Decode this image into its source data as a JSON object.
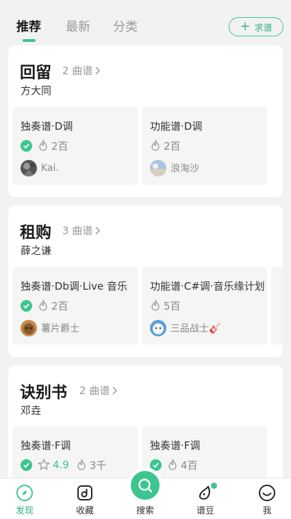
{
  "tabs": [
    "推荐",
    "最新",
    "分类"
  ],
  "request_button": "求谱",
  "cards": [
    {
      "title": "回留",
      "count": "2 曲谱",
      "artist": "方大同",
      "scores": [
        {
          "name": "独奏谱·D调",
          "verified": true,
          "heat": "2百",
          "user": "Kai."
        },
        {
          "name": "功能谱·D调",
          "verified": false,
          "heat": "2百",
          "user": "浪淘沙"
        }
      ]
    },
    {
      "title": "租购",
      "count": "3 曲谱",
      "artist": "薛之谦",
      "scores": [
        {
          "name": "独奏谱·Db调·Live 音乐",
          "verified": true,
          "heat": "2百",
          "user": "薯片爵士"
        },
        {
          "name": "功能谱·C#调·音乐缘计划",
          "verified": false,
          "heat": "5百",
          "user": "三品战士🎸"
        }
      ]
    },
    {
      "title": "诀别书",
      "count": "2 曲谱",
      "artist": "邓垚",
      "scores": [
        {
          "name": "独奏谱·F调",
          "verified": true,
          "rating": "4.9",
          "heat": "3千",
          "user": ""
        },
        {
          "name": "独奏谱·F调",
          "verified": true,
          "heat": "4百",
          "user": ""
        }
      ]
    }
  ],
  "nav": {
    "discover": "发现",
    "favorites": "收藏",
    "search": "搜索",
    "beans": "谱豆",
    "me": "我"
  },
  "colors": {
    "accent": "#3cc58f"
  }
}
